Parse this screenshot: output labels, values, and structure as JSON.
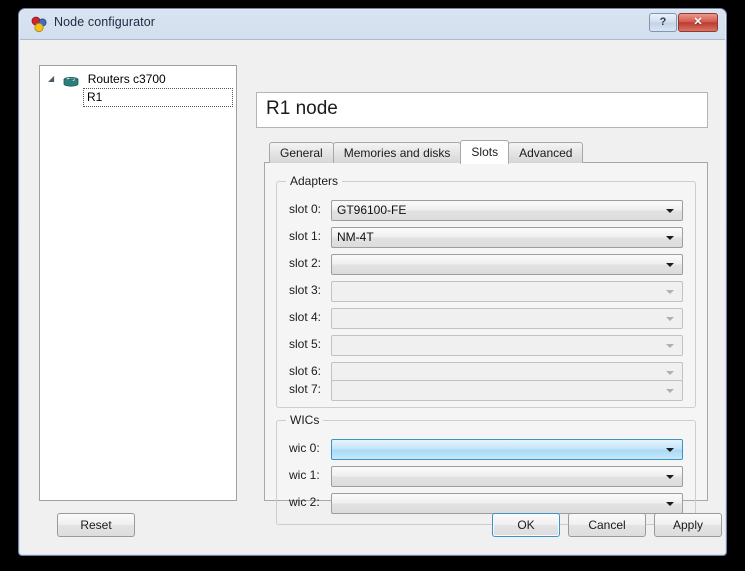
{
  "window": {
    "title": "Node configurator",
    "icon": "gns3-spheres-icon",
    "help_button": "?",
    "close_button": "✕"
  },
  "tree": {
    "root": {
      "label": "Routers c3700",
      "icon": "router-icon",
      "expander": "◢"
    },
    "child": {
      "label": "R1"
    }
  },
  "header": {
    "node_title": "R1 node"
  },
  "tabs": [
    {
      "label": "General",
      "active": false
    },
    {
      "label": "Memories and disks",
      "active": false
    },
    {
      "label": "Slots",
      "active": true
    },
    {
      "label": "Advanced",
      "active": false
    }
  ],
  "adapters": {
    "legend": "Adapters",
    "rows": [
      {
        "label": "slot 0:",
        "value": "GT96100-FE",
        "state": "enabled"
      },
      {
        "label": "slot 1:",
        "value": "NM-4T",
        "state": "enabled"
      },
      {
        "label": "slot 2:",
        "value": "",
        "state": "enabled"
      },
      {
        "label": "slot 3:",
        "value": "",
        "state": "disabled"
      },
      {
        "label": "slot 4:",
        "value": "",
        "state": "disabled"
      },
      {
        "label": "slot 5:",
        "value": "",
        "state": "disabled"
      },
      {
        "label": "slot 6:",
        "value": "",
        "state": "disabled"
      },
      {
        "label": "slot 7:",
        "value": "",
        "state": "disabled"
      }
    ]
  },
  "wics": {
    "legend": "WICs",
    "rows": [
      {
        "label": "wic 0:",
        "value": "",
        "state": "highlight"
      },
      {
        "label": "wic 1:",
        "value": "",
        "state": "enabled"
      },
      {
        "label": "wic 2:",
        "value": "",
        "state": "enabled"
      }
    ]
  },
  "buttons": {
    "reset": "Reset",
    "ok": "OK",
    "cancel": "Cancel",
    "apply": "Apply"
  },
  "colors": {
    "accent_blue": "#3c93c8",
    "title_bar": "#c8d6e8",
    "close_red": "#bc3b2e",
    "router_icon": "#2e7d7d",
    "panel_bg": "#f5f5f5"
  }
}
